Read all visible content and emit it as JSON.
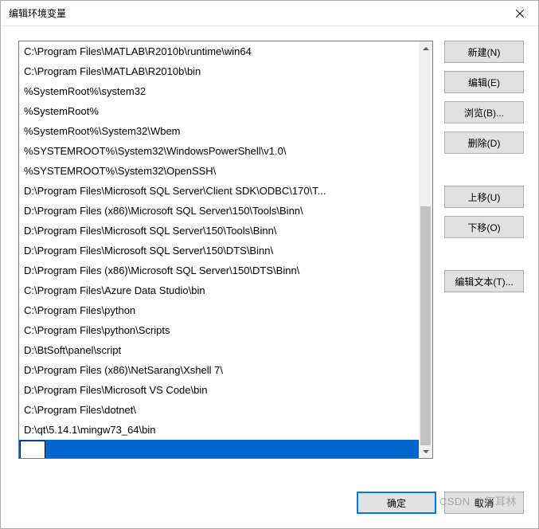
{
  "title": "编辑环境变量",
  "list": {
    "items": [
      "C:\\Program Files\\MATLAB\\R2010b\\runtime\\win64",
      "C:\\Program Files\\MATLAB\\R2010b\\bin",
      "%SystemRoot%\\system32",
      "%SystemRoot%",
      "%SystemRoot%\\System32\\Wbem",
      "%SYSTEMROOT%\\System32\\WindowsPowerShell\\v1.0\\",
      "%SYSTEMROOT%\\System32\\OpenSSH\\",
      "D:\\Program Files\\Microsoft SQL Server\\Client SDK\\ODBC\\170\\T...",
      "D:\\Program Files (x86)\\Microsoft SQL Server\\150\\Tools\\Binn\\",
      "D:\\Program Files\\Microsoft SQL Server\\150\\Tools\\Binn\\",
      "D:\\Program Files\\Microsoft SQL Server\\150\\DTS\\Binn\\",
      "D:\\Program Files (x86)\\Microsoft SQL Server\\150\\DTS\\Binn\\",
      "C:\\Program Files\\Azure Data Studio\\bin",
      "C:\\Program Files\\python",
      "C:\\Program Files\\python\\Scripts",
      "D:\\BtSoft\\panel\\script",
      "D:\\Program Files (x86)\\NetSarang\\Xshell 7\\",
      "D:\\Program Files\\Microsoft VS Code\\bin",
      "C:\\Program Files\\dotnet\\",
      "D:\\qt\\5.14.1\\mingw73_64\\bin"
    ],
    "edit_value": ""
  },
  "side_buttons": {
    "new": "新建(N)",
    "edit": "编辑(E)",
    "browse": "浏览(B)...",
    "delete": "删除(D)",
    "move_up": "上移(U)",
    "move_down": "下移(O)",
    "edit_text": "编辑文本(T)..."
  },
  "footer": {
    "ok": "确定",
    "cancel": "取消"
  },
  "watermark": "CSDN @何耳林"
}
